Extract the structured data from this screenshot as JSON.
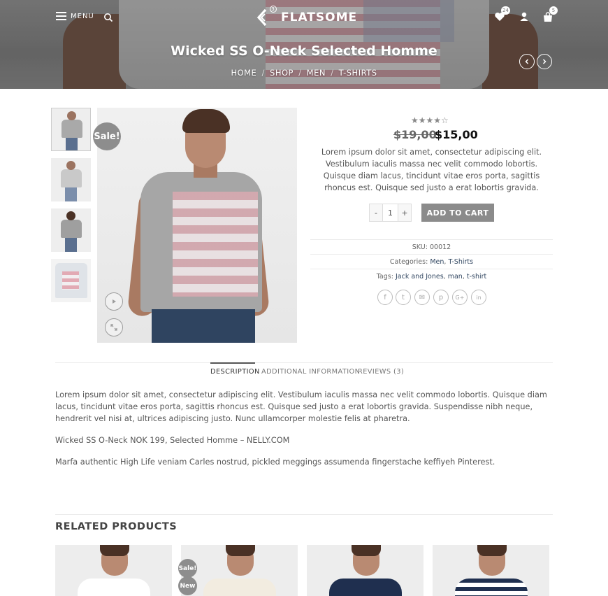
{
  "header": {
    "menu_label": "MENU",
    "logo_text": "FLATSOME",
    "logo_badge": "3",
    "wishlist_count": "24",
    "cart_count": "5",
    "icons": [
      "menu-icon",
      "search-icon",
      "heart-icon",
      "user-icon",
      "cart-icon"
    ]
  },
  "hero": {
    "title": "Wicked SS O-Neck Selected Homme",
    "breadcrumbs": [
      "HOME",
      "SHOP",
      "MEN",
      "T-SHIRTS"
    ],
    "separator": "/"
  },
  "product": {
    "sale_badge": "Sale!",
    "rating_stars": "★★★★☆",
    "price_old": "$19,00",
    "price_new": "$15,00",
    "short_description": "Lorem ipsum dolor sit amet, consectetur adipiscing elit. Vestibulum iaculis massa nec velit commodo lobortis. Quisque diam lacus, tincidunt vitae eros porta, sagittis rhoncus est. Quisque sed justo a erat lobortis gravida.",
    "qty_minus": "-",
    "qty_value": "1",
    "qty_plus": "+",
    "add_to_cart": "ADD TO CART",
    "sku_label": "SKU:",
    "sku_value": "00012",
    "categories_label": "Categories:",
    "categories": [
      "Men",
      "T-Shirts"
    ],
    "tags_label": "Tags:",
    "tags": [
      "Jack and Jones",
      "man",
      "t-shirt"
    ],
    "share_icons": [
      {
        "name": "facebook-icon",
        "glyph": "f"
      },
      {
        "name": "twitter-icon",
        "glyph": "t"
      },
      {
        "name": "email-icon",
        "glyph": "✉"
      },
      {
        "name": "pinterest-icon",
        "glyph": "p"
      },
      {
        "name": "google-plus-icon",
        "glyph": "G+"
      },
      {
        "name": "linkedin-icon",
        "glyph": "in"
      }
    ]
  },
  "tabs": {
    "items": [
      "DESCRIPTION",
      "ADDITIONAL INFORMATION",
      "REVIEWS (3)"
    ],
    "active": "DESCRIPTION"
  },
  "description": {
    "p1": "Lorem ipsum dolor sit amet, consectetur adipiscing elit. Vestibulum iaculis massa nec velit commodo lobortis. Quisque diam lacus, tincidunt vitae eros porta, sagittis rhoncus est. Quisque sed justo a erat lobortis gravida. Suspendisse nibh neque, hendrerit vel nisi at, ultrices adipiscing justo. Nunc ullamcorper molestie felis at pharetra.",
    "p2": "Wicked SS O-Neck NOK 199, Selected Homme – NELLY.COM",
    "p3": "Marfa authentic High Life veniam Carles nostrud, pickled meggings assumenda fingerstache keffiyeh Pinterest."
  },
  "related": {
    "title": "RELATED PRODUCTS",
    "badges": {
      "sale": "Sale!",
      "new": "New"
    }
  },
  "colors": {
    "badge": "#8d8d8d",
    "button": "#8b8b8b",
    "link": "#334862"
  }
}
